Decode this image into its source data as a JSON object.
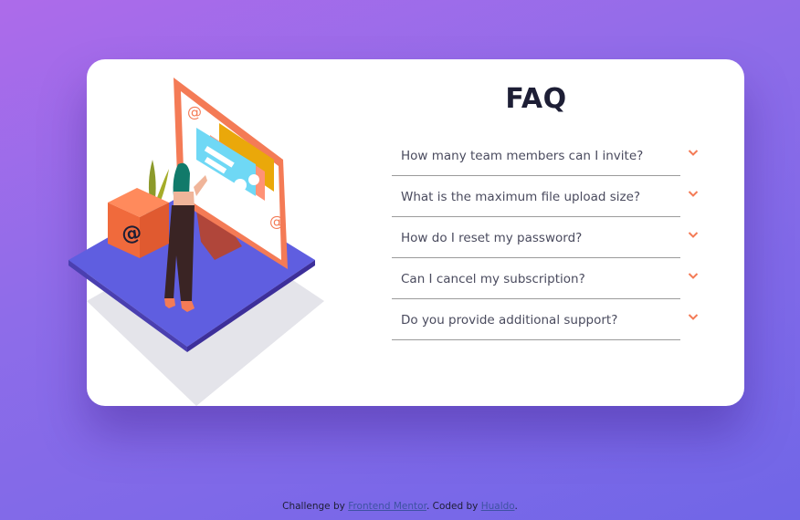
{
  "faq": {
    "title": "FAQ",
    "items": [
      {
        "question": "How many team members can I invite?"
      },
      {
        "question": "What is the maximum file upload size?"
      },
      {
        "question": "How do I reset my password?"
      },
      {
        "question": "Can I cancel my subscription?"
      },
      {
        "question": "Do you provide additional support?"
      }
    ],
    "chevron_icon": "chevron-down-icon"
  },
  "footer": {
    "prefix": "Challenge by ",
    "challenge_link": "Frontend Mentor",
    "middle": ". Coded by ",
    "author_link": "Hualdo",
    "suffix": "."
  },
  "colors": {
    "accent": "#f47b56",
    "heading": "#1d1e35",
    "text": "#4a4b5e",
    "divider": "#9b9b9b",
    "link": "#3e52a3",
    "background_start": "#ad6bea",
    "background_end": "#7066e7"
  }
}
